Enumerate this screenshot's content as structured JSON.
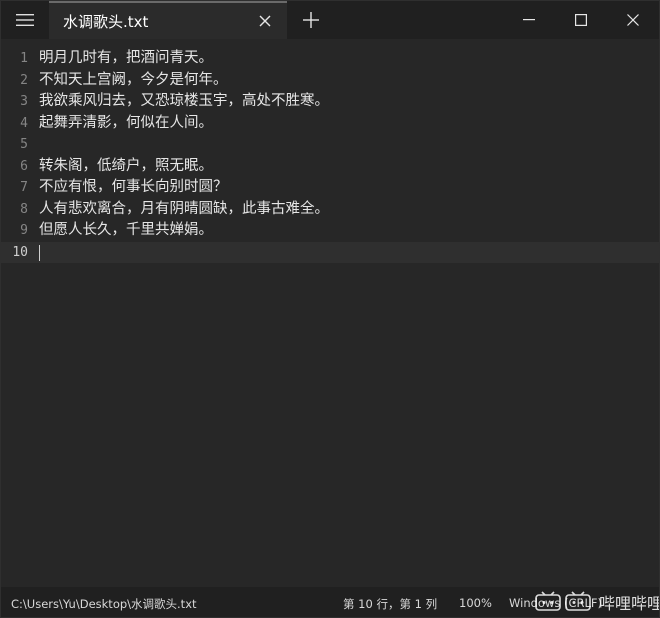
{
  "titlebar": {
    "tab_title": "水调歌头.txt"
  },
  "editor": {
    "lines": [
      {
        "num": "1",
        "text": "明月几时有，把酒问青天。"
      },
      {
        "num": "2",
        "text": "不知天上宫阙，今夕是何年。"
      },
      {
        "num": "3",
        "text": "我欲乘风归去，又恐琼楼玉宇，高处不胜寒。"
      },
      {
        "num": "4",
        "text": "起舞弄清影，何似在人间。"
      },
      {
        "num": "5",
        "text": ""
      },
      {
        "num": "6",
        "text": "转朱阁，低绮户，照无眠。"
      },
      {
        "num": "7",
        "text": "不应有恨，何事长向别时圆？"
      },
      {
        "num": "8",
        "text": "人有悲欢离合，月有阴晴圆缺，此事古难全。"
      },
      {
        "num": "9",
        "text": "但愿人长久，千里共婵娟。"
      },
      {
        "num": "10",
        "text": ""
      }
    ]
  },
  "statusbar": {
    "path": "C:\\Users\\Yu\\Desktop\\水调歌头.txt",
    "position": "第 10 行，第 1 列",
    "zoom": "100%",
    "encoding": "Windows (CRLF)"
  },
  "watermark": {
    "text": "哔哩哔哩"
  }
}
